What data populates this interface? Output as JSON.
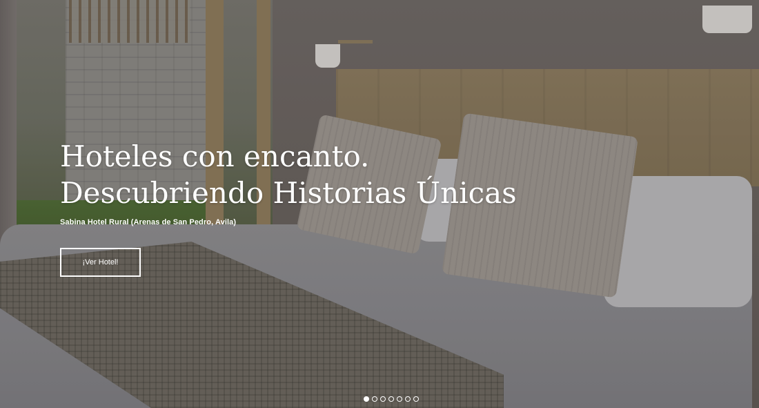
{
  "hero": {
    "headline_line1": "Hoteles con encanto.",
    "headline_line2": "Descubriendo Historias Únicas",
    "subtitle": "Sabina Hotel Rural (Arenas de San Pedro, Avila)",
    "cta_label": "¡Ver Hotel!",
    "background_image": "hotel-bedroom-photo"
  },
  "carousel": {
    "slide_count": 7,
    "active_index": 0
  },
  "colors": {
    "text": "#ffffff",
    "button_border": "#ffffff"
  }
}
